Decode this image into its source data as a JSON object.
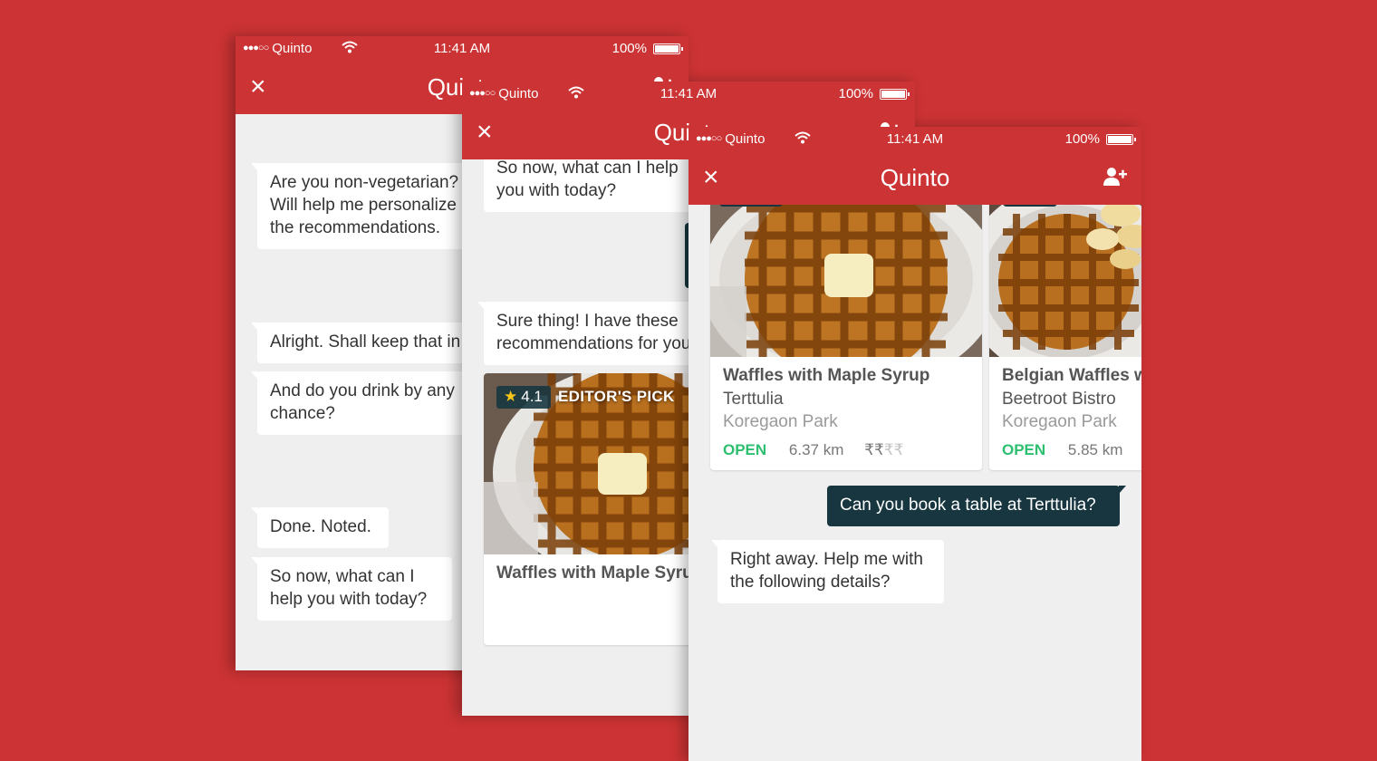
{
  "status_bar": {
    "signal": "●●●○○",
    "carrier": "Quinto",
    "time": "11:41 AM",
    "battery": "100%",
    "battery_level": 1.0
  },
  "nav": {
    "title": "Quinto",
    "close_icon": "×"
  },
  "icons": {
    "close": "close-icon",
    "add_user": "add-user-icon",
    "wifi": "wifi-icon",
    "battery": "battery-icon",
    "star": "star-icon"
  },
  "colors": {
    "brand_red": "#cc3334",
    "chat_background": "#efefef",
    "outgoing_bubble": "#173640",
    "open_status": "#2dbf70"
  },
  "phone1": {
    "messages": [
      "Are you non-vegetarian? Will help me personalize the recommendations.",
      "Alright. Shall keep that in mind.",
      "And do you drink by any chance?",
      "Done. Noted.",
      "So now, what can I help you with today?"
    ]
  },
  "phone2": {
    "messages": [
      "So now, what can I help you with today?",
      "Sure thing! I have these recommendations for you."
    ],
    "card": {
      "rating_star": "★",
      "rating": "4.1",
      "badge": "EDITOR'S PICK",
      "name": "Waffles with Maple Syrup"
    }
  },
  "phone3": {
    "cards": [
      {
        "name": "Waffles with Maple Syrup",
        "venue": "Terttulia",
        "area": "Koregaon Park",
        "status": "OPEN",
        "distance": "6.37 km",
        "price_on": "₹₹",
        "price_off": "₹₹"
      },
      {
        "name": "Belgian Waffles with Bananas",
        "venue": "Beetroot Bistro",
        "area": "Koregaon Park",
        "status": "OPEN",
        "distance": "5.85 km",
        "price_on": "₹₹",
        "price_off": "₹₹"
      }
    ],
    "sent_message": "Can you book a table at Terttulia?",
    "reply": "Right away. Help me with the following details?"
  }
}
